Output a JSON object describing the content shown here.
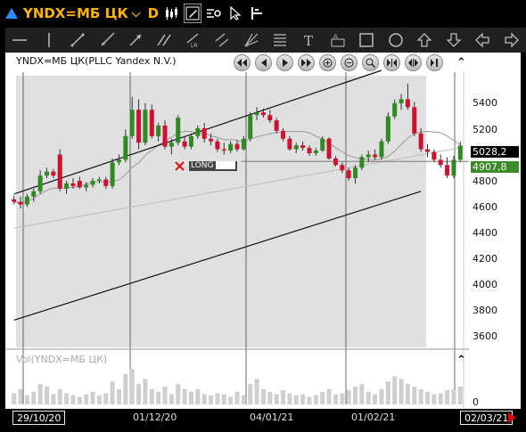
{
  "title_bar": {
    "symbol": "YNDX=МБ ЦК",
    "period": "D",
    "chevron": "⌵",
    "icons": [
      "candlestick-icon",
      "draw-edit-icon",
      "chart-settings-icon",
      "cursor-icon",
      "split-pane-icon"
    ]
  },
  "draw_toolbar": {
    "tools": [
      "horizontal-line-icon",
      "vertical-line-icon",
      "trend-line-icon",
      "ray-line-icon",
      "arrow-line-icon",
      "fibonacci-icon",
      "linear-regression-icon",
      "parallel-channel-icon",
      "pitchfork-icon",
      "fibonacci-levels-icon",
      "text-tool-icon",
      "label-tool-icon",
      "rectangle-icon",
      "ellipse-icon",
      "arrow-up-icon",
      "arrow-down-icon",
      "arrow-left-icon",
      "arrow-right-icon"
    ]
  },
  "chart": {
    "title": "YNDX=МБ ЦК(PLLC Yandex N.V.)",
    "nav_buttons": [
      "scroll-to-start-icon",
      "scroll-left-icon",
      "scroll-right-icon",
      "scroll-to-end-icon",
      "zoom-in-icon",
      "zoom-out-icon",
      "zoom-fit-icon",
      "compress-icon",
      "expand-icon",
      "pause-icon"
    ],
    "collapse_icon": "⌃",
    "y_labels": [
      "5400",
      "5200",
      "4800",
      "4600",
      "4400",
      "4200",
      "4000",
      "3800",
      "3600"
    ],
    "last_price": "5028,2",
    "level_price": "4907,8",
    "trade_marker": "LONG",
    "volume_title": "Vol(YNDX=МБ ЦК)",
    "volume_zero": "0",
    "date_labels": [
      "29/10/20",
      "01/12/20",
      "04/01/21",
      "01/02/21",
      "02/03/21"
    ]
  },
  "chart_data": {
    "type": "candlestick",
    "title": "YNDX=МБ ЦК(PLLC Yandex N.V.)",
    "ylim": [
      3500,
      5600
    ],
    "last_price": 5028.2,
    "horizontal_level": 4907.8,
    "x_start": "29/10/20",
    "x_end": "02/03/21",
    "candles": [
      {
        "o": 4620,
        "h": 4650,
        "l": 4580,
        "c": 4600
      },
      {
        "o": 4600,
        "h": 4640,
        "l": 4550,
        "c": 4580
      },
      {
        "o": 4580,
        "h": 4660,
        "l": 4560,
        "c": 4640
      },
      {
        "o": 4640,
        "h": 4700,
        "l": 4600,
        "c": 4680
      },
      {
        "o": 4680,
        "h": 4840,
        "l": 4660,
        "c": 4800
      },
      {
        "o": 4800,
        "h": 4860,
        "l": 4780,
        "c": 4830
      },
      {
        "o": 4830,
        "h": 4850,
        "l": 4780,
        "c": 4800
      },
      {
        "o": 4960,
        "h": 5000,
        "l": 4680,
        "c": 4700
      },
      {
        "o": 4700,
        "h": 4760,
        "l": 4660,
        "c": 4740
      },
      {
        "o": 4740,
        "h": 4780,
        "l": 4700,
        "c": 4720
      },
      {
        "o": 4760,
        "h": 4790,
        "l": 4700,
        "c": 4710
      },
      {
        "o": 4710,
        "h": 4750,
        "l": 4680,
        "c": 4730
      },
      {
        "o": 4730,
        "h": 4780,
        "l": 4710,
        "c": 4760
      },
      {
        "o": 4760,
        "h": 4790,
        "l": 4740,
        "c": 4770
      },
      {
        "o": 4770,
        "h": 4790,
        "l": 4700,
        "c": 4720
      },
      {
        "o": 4720,
        "h": 4930,
        "l": 4700,
        "c": 4900
      },
      {
        "o": 4900,
        "h": 4960,
        "l": 4880,
        "c": 4920
      },
      {
        "o": 4920,
        "h": 5150,
        "l": 4900,
        "c": 5100
      },
      {
        "o": 5100,
        "h": 5400,
        "l": 5080,
        "c": 5300
      },
      {
        "o": 5300,
        "h": 5380,
        "l": 5000,
        "c": 5050
      },
      {
        "o": 5050,
        "h": 5350,
        "l": 5030,
        "c": 5300
      },
      {
        "o": 5300,
        "h": 5340,
        "l": 5080,
        "c": 5100
      },
      {
        "o": 5100,
        "h": 5200,
        "l": 5060,
        "c": 5180
      },
      {
        "o": 5180,
        "h": 5220,
        "l": 5000,
        "c": 5020
      },
      {
        "o": 5020,
        "h": 5080,
        "l": 4960,
        "c": 5050
      },
      {
        "o": 5050,
        "h": 5260,
        "l": 5030,
        "c": 5240
      },
      {
        "o": 5060,
        "h": 5100,
        "l": 5000,
        "c": 5020
      },
      {
        "o": 5020,
        "h": 5120,
        "l": 5000,
        "c": 5100
      },
      {
        "o": 5100,
        "h": 5180,
        "l": 5080,
        "c": 5160
      },
      {
        "o": 5160,
        "h": 5200,
        "l": 5050,
        "c": 5080
      },
      {
        "o": 5080,
        "h": 5120,
        "l": 5030,
        "c": 5060
      },
      {
        "o": 5060,
        "h": 5080,
        "l": 4980,
        "c": 5000
      },
      {
        "o": 5000,
        "h": 5050,
        "l": 4960,
        "c": 4990
      },
      {
        "o": 4990,
        "h": 5060,
        "l": 4970,
        "c": 5040
      },
      {
        "o": 5040,
        "h": 5070,
        "l": 4980,
        "c": 5000
      },
      {
        "o": 5000,
        "h": 5100,
        "l": 4990,
        "c": 5080
      },
      {
        "o": 5080,
        "h": 5280,
        "l": 5060,
        "c": 5260
      },
      {
        "o": 5260,
        "h": 5320,
        "l": 5220,
        "c": 5280
      },
      {
        "o": 5280,
        "h": 5310,
        "l": 5240,
        "c": 5260
      },
      {
        "o": 5260,
        "h": 5300,
        "l": 5200,
        "c": 5220
      },
      {
        "o": 5220,
        "h": 5240,
        "l": 5120,
        "c": 5140
      },
      {
        "o": 5140,
        "h": 5160,
        "l": 5060,
        "c": 5080
      },
      {
        "o": 5080,
        "h": 5100,
        "l": 4990,
        "c": 5000
      },
      {
        "o": 5000,
        "h": 5050,
        "l": 4970,
        "c": 5030
      },
      {
        "o": 5030,
        "h": 5060,
        "l": 4990,
        "c": 5010
      },
      {
        "o": 5010,
        "h": 5030,
        "l": 4950,
        "c": 4970
      },
      {
        "o": 4970,
        "h": 5010,
        "l": 4950,
        "c": 4990
      },
      {
        "o": 4990,
        "h": 5100,
        "l": 4980,
        "c": 5080
      },
      {
        "o": 5080,
        "h": 5090,
        "l": 4920,
        "c": 4930
      },
      {
        "o": 4930,
        "h": 4950,
        "l": 4870,
        "c": 4880
      },
      {
        "o": 4880,
        "h": 4900,
        "l": 4820,
        "c": 4840
      },
      {
        "o": 4840,
        "h": 4860,
        "l": 4760,
        "c": 4780
      },
      {
        "o": 4780,
        "h": 4880,
        "l": 4740,
        "c": 4860
      },
      {
        "o": 4860,
        "h": 4960,
        "l": 4840,
        "c": 4940
      },
      {
        "o": 4940,
        "h": 4990,
        "l": 4900,
        "c": 4960
      },
      {
        "o": 4960,
        "h": 5000,
        "l": 4920,
        "c": 4940
      },
      {
        "o": 4940,
        "h": 5080,
        "l": 4920,
        "c": 5060
      },
      {
        "o": 5060,
        "h": 5280,
        "l": 5040,
        "c": 5250
      },
      {
        "o": 5250,
        "h": 5380,
        "l": 5230,
        "c": 5350
      },
      {
        "o": 5350,
        "h": 5420,
        "l": 5300,
        "c": 5380
      },
      {
        "o": 5380,
        "h": 5500,
        "l": 5300,
        "c": 5320
      },
      {
        "o": 5320,
        "h": 5360,
        "l": 5100,
        "c": 5120
      },
      {
        "o": 5120,
        "h": 5160,
        "l": 4980,
        "c": 5000
      },
      {
        "o": 5000,
        "h": 5040,
        "l": 4940,
        "c": 4980
      },
      {
        "o": 4980,
        "h": 5000,
        "l": 4900,
        "c": 4920
      },
      {
        "o": 4920,
        "h": 4960,
        "l": 4860,
        "c": 4880
      },
      {
        "o": 4880,
        "h": 4940,
        "l": 4780,
        "c": 4800
      },
      {
        "o": 4800,
        "h": 4950,
        "l": 4780,
        "c": 4920
      },
      {
        "o": 4920,
        "h": 5060,
        "l": 4900,
        "c": 5028
      }
    ],
    "volumes": [
      22,
      30,
      18,
      25,
      40,
      35,
      20,
      30,
      22,
      18,
      15,
      20,
      25,
      18,
      22,
      45,
      30,
      60,
      70,
      40,
      50,
      30,
      25,
      35,
      20,
      40,
      30,
      25,
      30,
      20,
      18,
      22,
      20,
      15,
      25,
      18,
      40,
      50,
      30,
      25,
      20,
      28,
      22,
      18,
      20,
      15,
      18,
      25,
      30,
      20,
      22,
      28,
      35,
      40,
      25,
      20,
      30,
      45,
      55,
      50,
      40,
      35,
      30,
      25,
      20,
      22,
      28,
      30,
      35
    ],
    "channel": {
      "upper": [
        {
          "i": 0,
          "p": 4660
        },
        {
          "i": 56,
          "p": 5600
        }
      ],
      "lower": [
        {
          "i": 0,
          "p": 3700
        },
        {
          "i": 62,
          "p": 4680
        }
      ]
    }
  },
  "colors": {
    "up": "#2e8b1f",
    "down": "#d01030",
    "last_price_box": "#000000",
    "level_box": "#3d8a2a",
    "accent": "#ffb400",
    "triangle": "#2a8bff"
  }
}
